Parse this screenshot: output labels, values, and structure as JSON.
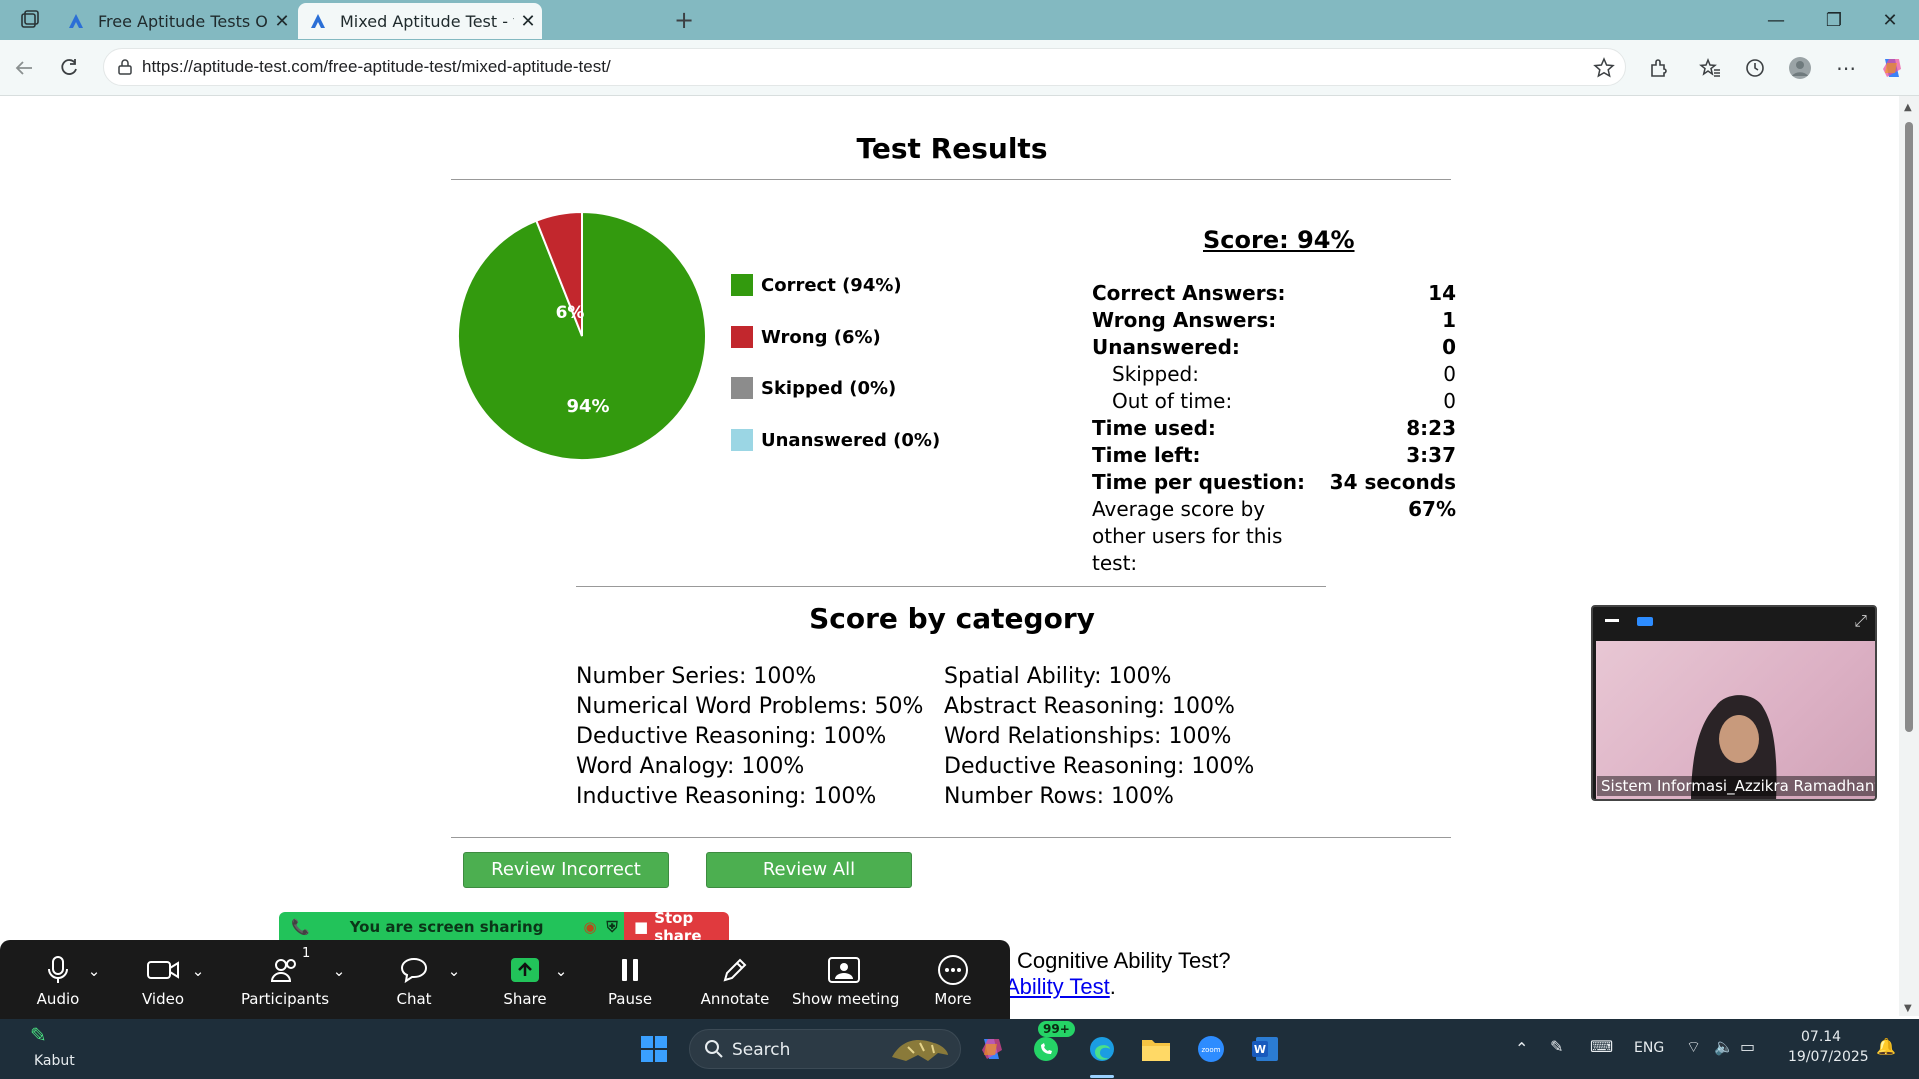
{
  "browser": {
    "tabs": [
      {
        "title": "Free Aptitude Tests Online - Aptit",
        "active": false
      },
      {
        "title": "Mixed Aptitude Test - free aptitud",
        "active": true
      }
    ],
    "url": "https://aptitude-test.com/free-aptitude-test/mixed-aptitude-test/"
  },
  "results": {
    "title": "Test Results",
    "score_label": "Score: 94%",
    "pie": {
      "correct_pct": 94,
      "wrong_pct": 6,
      "correct_label": "94%",
      "wrong_label": "6%",
      "colors": {
        "correct": "#339a0e",
        "wrong": "#c2272d",
        "skipped": "#8c8c8c",
        "unanswered": "#9bd6e4"
      }
    },
    "legend": [
      "Correct (94%)",
      "Wrong (6%)",
      "Skipped (0%)",
      "Unanswered (0%)"
    ],
    "stats": [
      {
        "label": "Correct Answers:",
        "value": "14"
      },
      {
        "label": "Wrong Answers:",
        "value": "1"
      },
      {
        "label": "Unanswered:",
        "value": "0"
      },
      {
        "label": "Skipped:",
        "value": "0"
      },
      {
        "label": "Out of time:",
        "value": "0"
      },
      {
        "label": "Time used:",
        "value": "8:23"
      },
      {
        "label": "Time left:",
        "value": "3:37"
      },
      {
        "label": "Time per question:",
        "value": "34 seconds"
      },
      {
        "label": "Average score by other users for this test:",
        "value": "67%"
      }
    ]
  },
  "category": {
    "title": "Score by category",
    "left": [
      "Number Series: 100%",
      "Numerical Word Problems: 50%",
      "Deductive Reasoning: 100%",
      "Word Analogy: 100%",
      "Inductive Reasoning: 100%"
    ],
    "right": [
      "Spatial Ability: 100%",
      "Abstract Reasoning: 100%",
      "Word Relationships: 100%",
      "Deductive Reasoning: 100%",
      "Number Rows: 100%"
    ]
  },
  "buttons": {
    "review_incorrect": "Review Incorrect",
    "review_all": "Review All"
  },
  "below": {
    "line1": "Cognitive Ability Test?",
    "line2": "Ability Test",
    "line2_tail": "."
  },
  "zoom": {
    "sharing_text": "You are screen sharing",
    "stop_share": "Stop share",
    "participants_count": "1",
    "items": [
      "Audio",
      "Video",
      "Participants",
      "Chat",
      "Share",
      "Pause",
      "Annotate",
      "Show meeting",
      "More"
    ],
    "video_name": "Sistem Informasi_Azzikra Ramadhanti..."
  },
  "taskbar": {
    "weather": "Kabut",
    "search": "Search",
    "badge": "99+",
    "lang": "ENG",
    "time": "07.14",
    "date": "19/07/2025"
  }
}
